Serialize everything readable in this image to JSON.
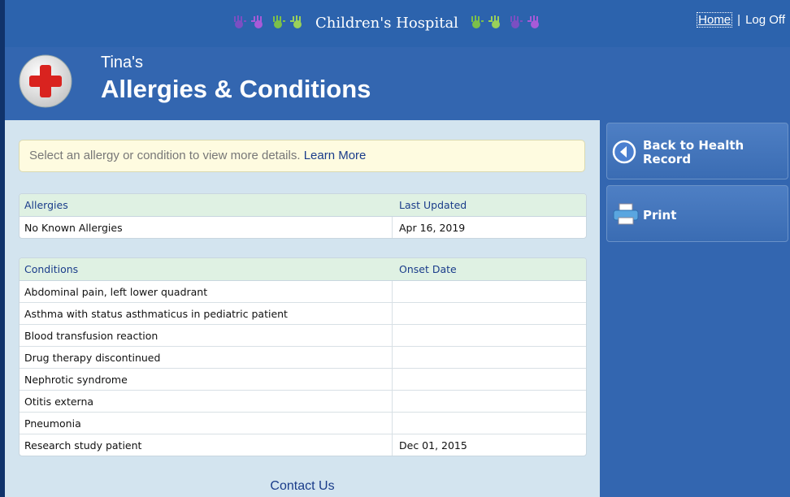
{
  "topbar": {
    "brand": "Children's Hospital",
    "nav_home": "Home",
    "nav_sep": "|",
    "nav_logoff": "Log Off"
  },
  "header": {
    "patient_name": "Tina's",
    "title": "Allergies & Conditions"
  },
  "notice": {
    "text": "Select an allergy or condition to view more details.",
    "link": "Learn More"
  },
  "allergies": {
    "columns": [
      "Allergies",
      "Last Updated"
    ],
    "rows": [
      [
        "No Known Allergies",
        "Apr 16, 2019"
      ]
    ]
  },
  "conditions": {
    "columns": [
      "Conditions",
      "Onset Date"
    ],
    "rows": [
      [
        "Abdominal pain, left lower quadrant",
        ""
      ],
      [
        "Asthma with status asthmaticus in pediatric patient",
        ""
      ],
      [
        "Blood transfusion reaction",
        ""
      ],
      [
        "Drug therapy discontinued",
        ""
      ],
      [
        "Nephrotic syndrome",
        ""
      ],
      [
        "Otitis externa",
        ""
      ],
      [
        "Pneumonia",
        ""
      ],
      [
        "Research study patient",
        "Dec 01, 2015"
      ]
    ]
  },
  "footer": {
    "contact": "Contact Us"
  },
  "sidebar": {
    "back_label_1": "Back to Health",
    "back_label_2": "Record",
    "print_label": "Print"
  },
  "colors": {
    "header_blue": "#3366b0",
    "main_bg": "#d3e4ef",
    "table_header": "#dff1e3",
    "notice_bg": "#fefbe0",
    "link": "#1a3c8a"
  },
  "icons": [
    "red-cross-icon",
    "back-arrow-icon",
    "printer-icon",
    "handprint-icon"
  ]
}
